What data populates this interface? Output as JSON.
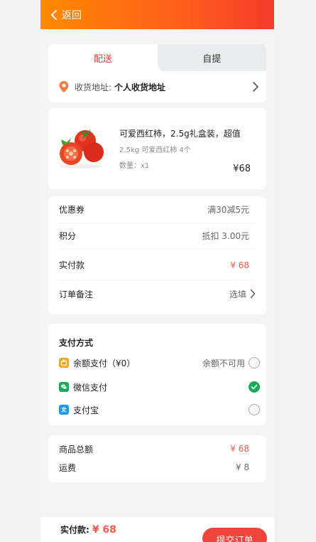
{
  "header": {
    "back_label": "返回"
  },
  "delivery": {
    "tabs": [
      "配送",
      "自提"
    ],
    "active_tab": 0,
    "address_label": "收货地址:",
    "address_value": "个人收货地址"
  },
  "product": {
    "title": "可爱西红柿，2.5g礼盒装，超值",
    "spec": "2.5kg 可爱西红柿 4个",
    "quantity": "数量：x1",
    "price": "¥68"
  },
  "order_rows": [
    {
      "label": "优惠券",
      "value": "满30减5元"
    },
    {
      "label": "积分",
      "value": "抵扣 3.00元"
    },
    {
      "label": "实付款",
      "value": "¥ 68"
    },
    {
      "label": "订单备注",
      "value": "选填"
    }
  ],
  "payment": {
    "title": "支付方式",
    "methods": [
      {
        "label": "余额支付（¥0）",
        "note": "余额不可用",
        "icon": "wallet-icon",
        "selected": false
      },
      {
        "label": "微信支付",
        "note": "",
        "icon": "wechat-icon",
        "selected": true
      },
      {
        "label": "支付宝",
        "note": "",
        "icon": "alipay-icon",
        "selected": false
      }
    ]
  },
  "summary": [
    {
      "label": "商品总额",
      "value": "¥ 68"
    },
    {
      "label": "运费",
      "value": "¥ 8"
    }
  ],
  "footer": {
    "total_label": "实付款:",
    "total_value": "¥ 68",
    "submit_label": "提交订单"
  },
  "colors": {
    "header_gradient_start": "#ff8a00",
    "header_gradient_end": "#f33b2a",
    "accent_red": "#f05a4a",
    "wechat_green": "#1aaa55",
    "alipay_blue": "#1e9be8",
    "wallet_orange": "#f5a623"
  }
}
